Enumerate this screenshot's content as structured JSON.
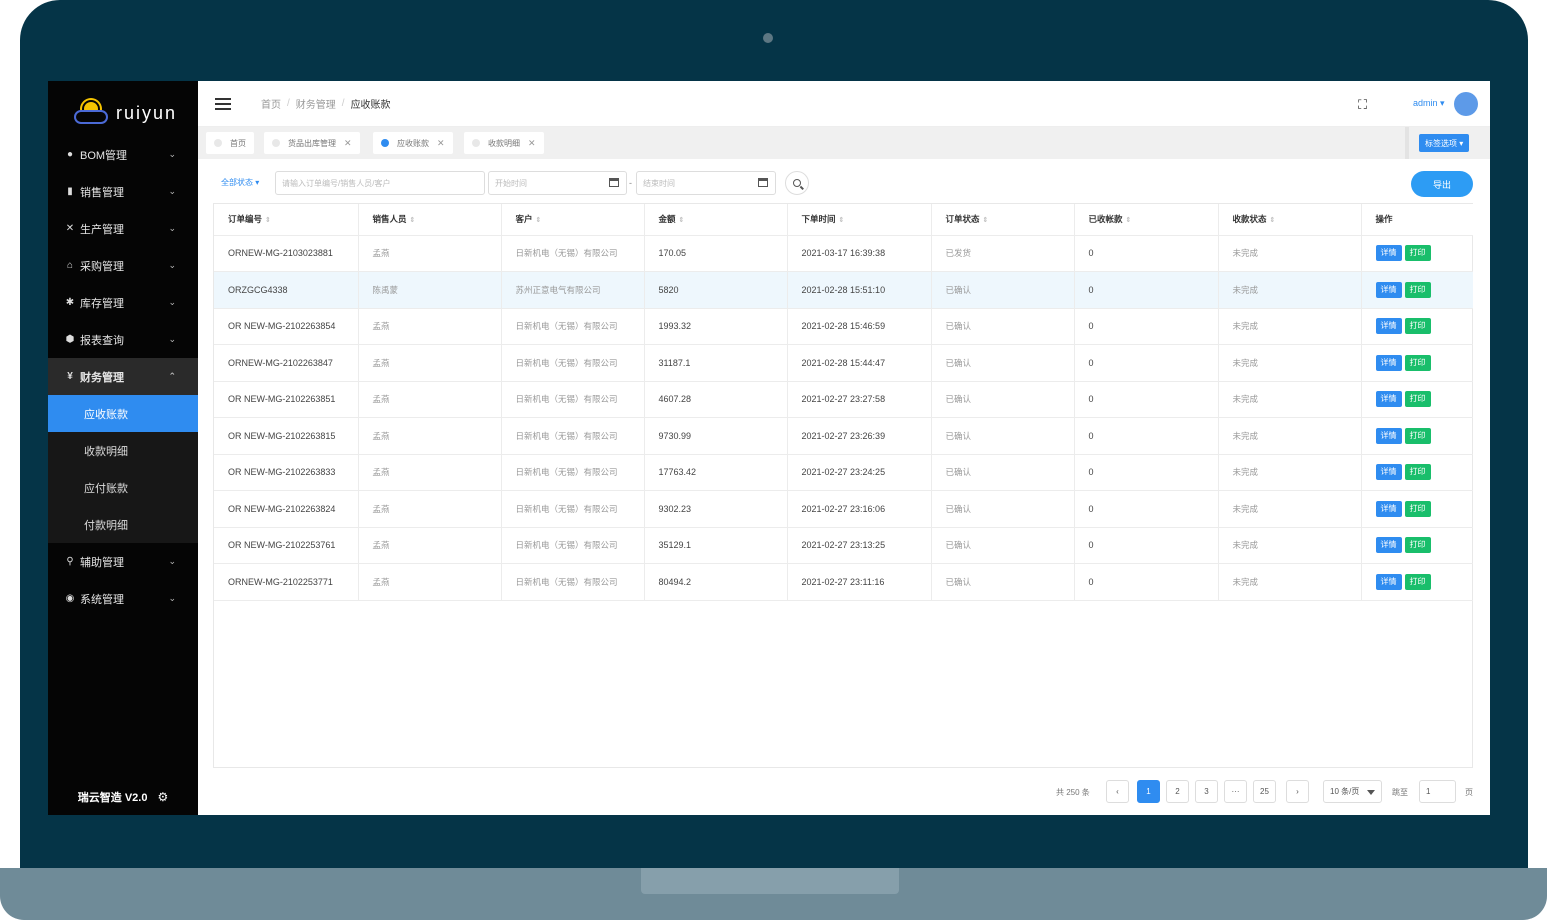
{
  "app": {
    "logo_text": "ruiyun",
    "footer_text": "瑞云智造 V2.0"
  },
  "sidebar": {
    "items": [
      {
        "label": "BOM管理",
        "icon": "gear-dot-icon"
      },
      {
        "label": "销售管理",
        "icon": "doc-icon"
      },
      {
        "label": "生产管理",
        "icon": "tools-icon"
      },
      {
        "label": "采购管理",
        "icon": "bag-icon"
      },
      {
        "label": "库存管理",
        "icon": "cog-icon"
      },
      {
        "label": "报表查询",
        "icon": "box-icon"
      },
      {
        "label": "财务管理",
        "icon": "yen-icon"
      },
      {
        "label": "辅助管理",
        "icon": "search-icon"
      },
      {
        "label": "系统管理",
        "icon": "robot-icon"
      }
    ],
    "finance_sub": [
      "应收账款",
      "收款明细",
      "应付账款",
      "付款明细"
    ]
  },
  "header": {
    "breadcrumb": [
      "首页",
      "财务管理",
      "应收账款"
    ],
    "user": "admin"
  },
  "tags": {
    "items": [
      "首页",
      "货品出库管理",
      "应收账款",
      "收款明细"
    ],
    "options_label": "标签选项"
  },
  "filter": {
    "status_label": "全部状态",
    "search_placeholder": "请输入订单编号/销售人员/客户",
    "start_placeholder": "开始时间",
    "end_placeholder": "结束时间",
    "export_label": "导出"
  },
  "table": {
    "columns": [
      "订单编号",
      "销售人员",
      "客户",
      "金额",
      "下单时间",
      "订单状态",
      "已收帐款",
      "收款状态",
      "操作"
    ],
    "action_detail": "详情",
    "action_print": "打印",
    "rows": [
      [
        "ORNEW-MG-2103023881",
        "孟燕",
        "日新机电（无锡）有限公司",
        "170.05",
        "2021-03-17 16:39:38",
        "已发货",
        "0",
        "未完成"
      ],
      [
        "ORZGCG4338",
        "陈禹蒙",
        "苏州正意电气有限公司",
        "5820",
        "2021-02-28 15:51:10",
        "已确认",
        "0",
        "未完成"
      ],
      [
        "OR NEW-MG-2102263854",
        "孟燕",
        "日新机电（无锡）有限公司",
        "1993.32",
        "2021-02-28 15:46:59",
        "已确认",
        "0",
        "未完成"
      ],
      [
        "ORNEW-MG-2102263847",
        "孟燕",
        "日新机电（无锡）有限公司",
        "31187.1",
        "2021-02-28 15:44:47",
        "已确认",
        "0",
        "未完成"
      ],
      [
        "OR NEW-MG-2102263851",
        "孟燕",
        "日新机电（无锡）有限公司",
        "4607.28",
        "2021-02-27 23:27:58",
        "已确认",
        "0",
        "未完成"
      ],
      [
        "OR NEW-MG-2102263815",
        "孟燕",
        "日新机电（无锡）有限公司",
        "9730.99",
        "2021-02-27 23:26:39",
        "已确认",
        "0",
        "未完成"
      ],
      [
        "OR NEW-MG-2102263833",
        "孟燕",
        "日新机电（无锡）有限公司",
        "17763.42",
        "2021-02-27 23:24:25",
        "已确认",
        "0",
        "未完成"
      ],
      [
        "OR NEW-MG-2102263824",
        "孟燕",
        "日新机电（无锡）有限公司",
        "9302.23",
        "2021-02-27 23:16:06",
        "已确认",
        "0",
        "未完成"
      ],
      [
        "OR NEW-MG-2102253761",
        "孟燕",
        "日新机电（无锡）有限公司",
        "35129.1",
        "2021-02-27 23:13:25",
        "已确认",
        "0",
        "未完成"
      ],
      [
        "ORNEW-MG-2102253771",
        "孟燕",
        "日新机电（无锡）有限公司",
        "80494.2",
        "2021-02-27 23:11:16",
        "已确认",
        "0",
        "未完成"
      ]
    ]
  },
  "pagination": {
    "total_label": "共 250 条",
    "pages": [
      "1",
      "2",
      "3",
      "···",
      "25"
    ],
    "prev": "‹",
    "next": "›",
    "page_size": "10 条/页",
    "goto_label": "跳至",
    "goto_value": "1",
    "page_label": "页"
  },
  "colors": {
    "primary": "#2f8cf0",
    "success": "#19be6b",
    "sidebar": "#050505",
    "frame": "#053447"
  }
}
